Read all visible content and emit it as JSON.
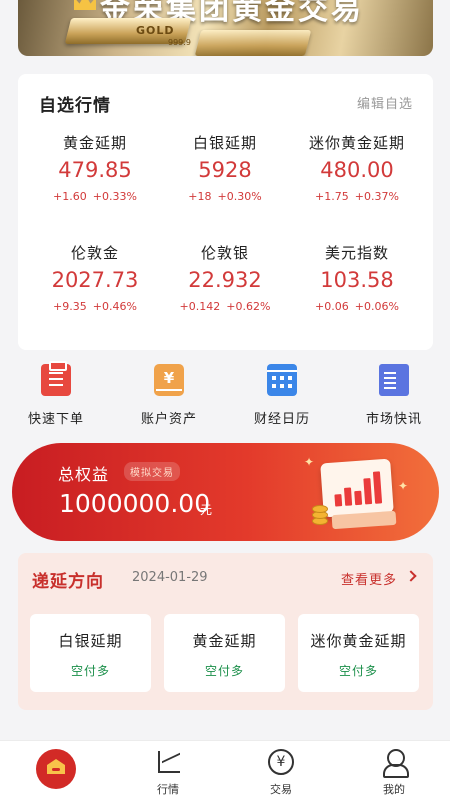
{
  "banner": {
    "headline": "金荣集团黄金交易",
    "bar_label": "GOLD",
    "bar_sub": "999.9"
  },
  "watchlist": {
    "title": "自选行情",
    "edit_label": "编辑自选",
    "items": [
      {
        "name": "黄金延期",
        "price": "479.85",
        "change": "+1.60",
        "pct": "+0.33%"
      },
      {
        "name": "白银延期",
        "price": "5928",
        "change": "+18",
        "pct": "+0.30%"
      },
      {
        "name": "迷你黄金延期",
        "price": "480.00",
        "change": "+1.75",
        "pct": "+0.37%"
      },
      {
        "name": "伦敦金",
        "price": "2027.73",
        "change": "+9.35",
        "pct": "+0.46%"
      },
      {
        "name": "伦敦银",
        "price": "22.932",
        "change": "+0.142",
        "pct": "+0.62%"
      },
      {
        "name": "美元指数",
        "price": "103.58",
        "change": "+0.06",
        "pct": "+0.06%"
      }
    ]
  },
  "quick_actions": [
    {
      "label": "快速下单",
      "icon": "order-icon"
    },
    {
      "label": "账户资产",
      "icon": "assets-icon"
    },
    {
      "label": "财经日历",
      "icon": "calendar-icon"
    },
    {
      "label": "市场快讯",
      "icon": "news-icon"
    }
  ],
  "equity": {
    "title": "总权益",
    "tag": "模拟交易",
    "value": "1000000.00",
    "unit": "元"
  },
  "rollover": {
    "title": "递延方向",
    "date": "2024-01-29",
    "more_label": "查看更多",
    "items": [
      {
        "name": "白银延期",
        "direction": "空付多"
      },
      {
        "name": "黄金延期",
        "direction": "空付多"
      },
      {
        "name": "迷你黄金延期",
        "direction": "空付多"
      }
    ]
  },
  "nav": {
    "tabs": [
      {
        "label": "",
        "icon": "home-icon"
      },
      {
        "label": "行情",
        "icon": "trend-icon"
      },
      {
        "label": "交易",
        "icon": "yen-icon"
      },
      {
        "label": "我的",
        "icon": "user-icon"
      }
    ]
  },
  "colors": {
    "up": "#d23a3a",
    "accent": "#c8302c",
    "rollover_direction": "#1b8f4a",
    "page_bg": "#f4f4f6"
  }
}
